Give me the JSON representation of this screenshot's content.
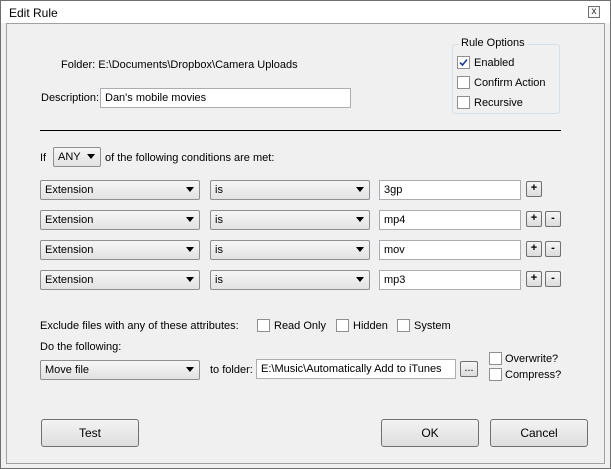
{
  "window": {
    "title": "Edit Rule",
    "close_glyph": "x"
  },
  "rule_options": {
    "group_label": "Rule Options",
    "enabled": {
      "label": "Enabled",
      "checked": true
    },
    "confirm_action": {
      "label": "Confirm Action",
      "checked": false
    },
    "recursive": {
      "label": "Recursive",
      "checked": false
    }
  },
  "folder": {
    "label": "Folder: E:\\Documents\\Dropbox\\Camera Uploads"
  },
  "description": {
    "label": "Description:",
    "value": "Dan's mobile movies"
  },
  "condition_header": {
    "prefix": "If",
    "match": "ANY",
    "suffix": "of the following conditions are met:"
  },
  "conditions": [
    {
      "field": "Extension",
      "op": "is",
      "value": "3gp",
      "remove": false
    },
    {
      "field": "Extension",
      "op": "is",
      "value": "mp4",
      "remove": true
    },
    {
      "field": "Extension",
      "op": "is",
      "value": "mov",
      "remove": true
    },
    {
      "field": "Extension",
      "op": "is",
      "value": "mp3",
      "remove": true
    }
  ],
  "add_glyph": "+",
  "remove_glyph": "-",
  "exclude": {
    "label": "Exclude files with any of these attributes:",
    "read_only": {
      "label": "Read Only",
      "checked": false
    },
    "hidden": {
      "label": "Hidden",
      "checked": false
    },
    "system": {
      "label": "System",
      "checked": false
    }
  },
  "action": {
    "label": "Do the following:",
    "value": "Move file",
    "to_folder_label": "to folder:",
    "folder_value": "E:\\Music\\Automatically Add to iTunes",
    "browse_label": "...",
    "overwrite": {
      "label": "Overwrite?",
      "checked": false
    },
    "compress": {
      "label": "Compress?",
      "checked": false
    }
  },
  "buttons": {
    "test": "Test",
    "ok": "OK",
    "cancel": "Cancel"
  }
}
